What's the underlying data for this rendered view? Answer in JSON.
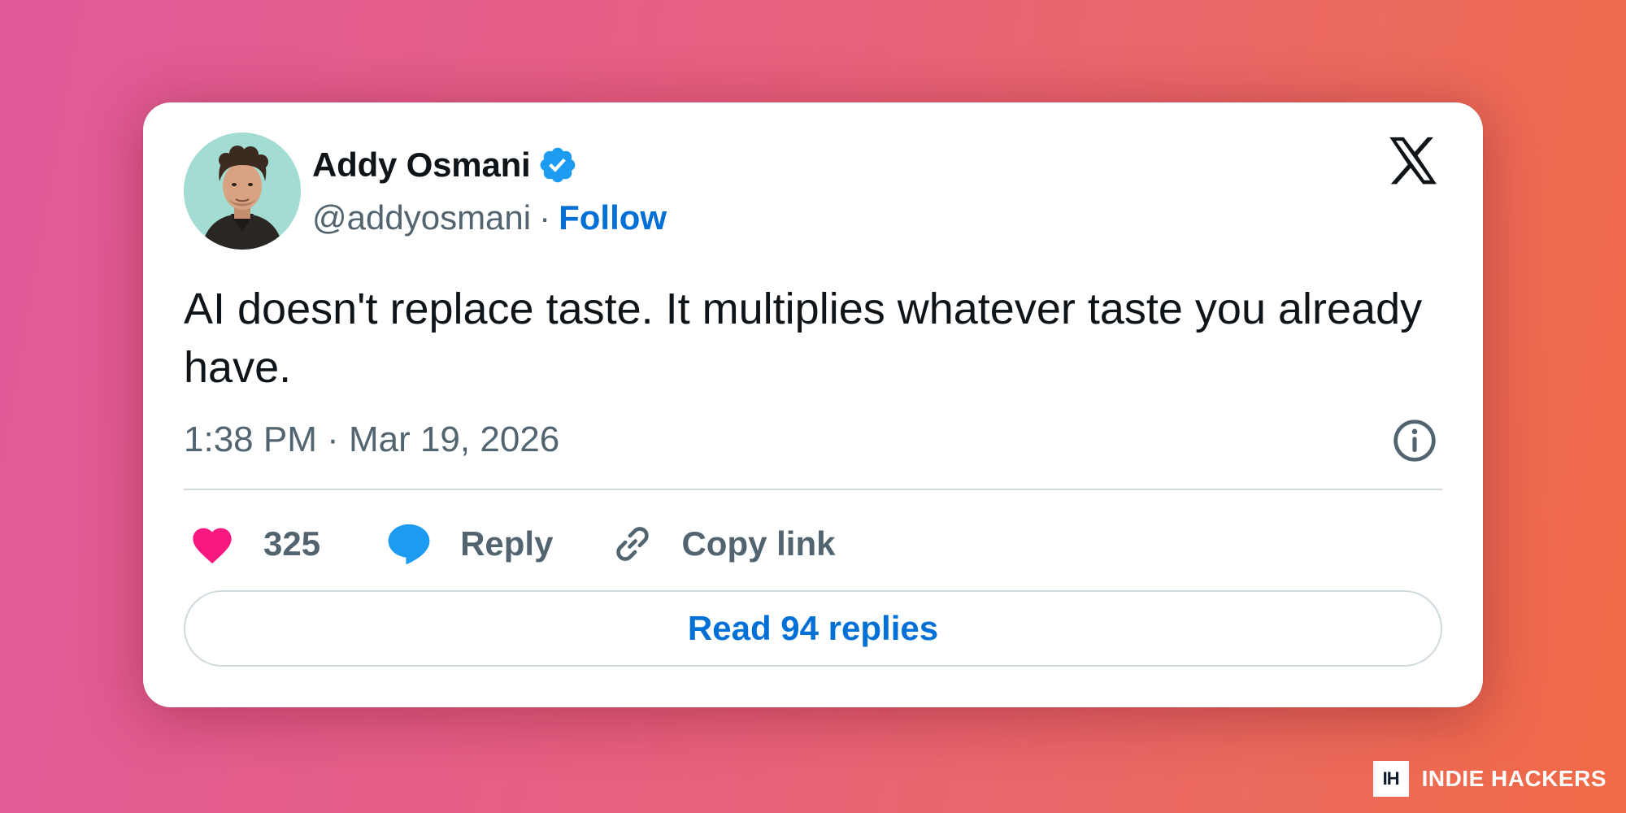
{
  "author": {
    "name": "Addy Osmani",
    "handle": "@addyosmani",
    "separator": "·",
    "follow_label": "Follow",
    "verified": true
  },
  "tweet": {
    "text": "AI doesn't replace taste. It multiplies whatever taste you already have.",
    "timestamp": "1:38 PM · Mar 19, 2026"
  },
  "actions": {
    "like_count": "325",
    "reply_label": "Reply",
    "copy_link_label": "Copy link",
    "read_replies_label": "Read 94 replies"
  },
  "brand": {
    "logo_text": "IH",
    "name": "INDIE HACKERS"
  },
  "icons": [
    "x-logo-icon",
    "verified-badge-icon",
    "info-icon",
    "heart-icon",
    "reply-bubble-icon",
    "link-icon"
  ],
  "colors": {
    "accent": "#006fd6",
    "verified": "#1d9bf0",
    "heart": "#f91880",
    "text_primary": "#0f1419",
    "text_secondary": "#536471"
  }
}
